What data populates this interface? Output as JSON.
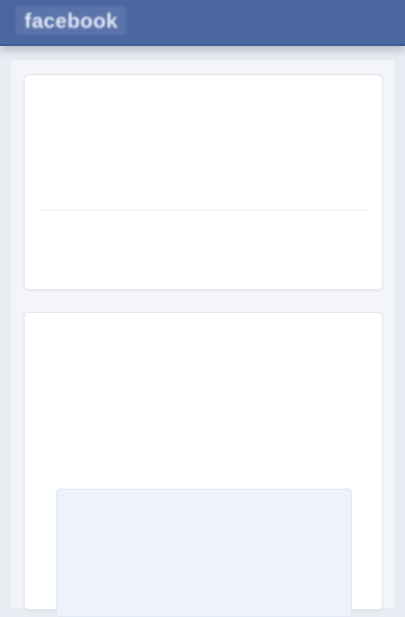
{
  "brand": "facebook",
  "header": {
    "logo_text": "facebook"
  },
  "card1": {
    "heading": "",
    "line1": "",
    "line1b": "",
    "line2": "",
    "row_text": "",
    "link_label": ""
  },
  "card2": {
    "title": "",
    "line1": "",
    "line2": "",
    "subheading": "",
    "panel_line1": "",
    "panel_line2": "",
    "panel_line3": ""
  }
}
